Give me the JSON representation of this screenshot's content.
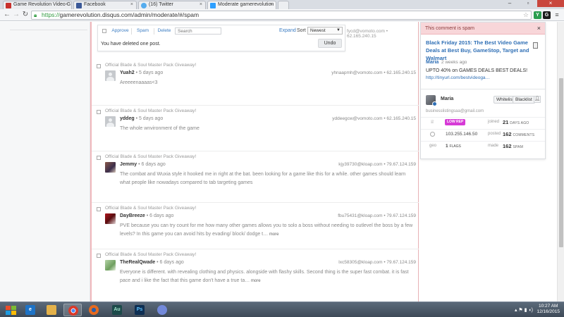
{
  "browser": {
    "tabs": [
      {
        "label": "Game Revolution Video G",
        "favicon_color": "#c8312d",
        "active": false
      },
      {
        "label": "Facebook",
        "favicon_color": "#3b5998",
        "active": false
      },
      {
        "label": "(16) Twitter",
        "favicon_color": "#55acee",
        "active": false
      },
      {
        "label": "Moderate gamerevolution",
        "favicon_color": "#2e9fff",
        "active": true
      }
    ],
    "url_scheme": "https://",
    "url_host": "gamerevolution.disqus.com",
    "url_path": "/admin/moderate/#/spam",
    "ext_y": "Y",
    "ext_g": "G"
  },
  "actionbar": {
    "approve": "Approve",
    "spam": "Spam",
    "delete": "Delete",
    "search_placeholder": "Search",
    "expand": "Expand",
    "sort_label": "Sort",
    "sort_value": "Newest",
    "deleted_msg": "You have deleted one post.",
    "undo": "Undo",
    "partial_meta": "fycd@vomoto.com • 62.165.240.15"
  },
  "comments": [
    {
      "thread": "Official Blade & Soul Master Pack Giveaway!",
      "author": "Yuah2",
      "time": " • 5 days ago",
      "email": "yhnaapmh@vomoto.com • 62.165.240.15",
      "text": "Areeeenaaaas<3",
      "more": ""
    },
    {
      "thread": "Official Blade & Soul Master Pack Giveaway!",
      "author": "yddeg",
      "time": " • 5 days ago",
      "email": "yddeegcw@vomoto.com • 62.165.240.15",
      "text": "The whole wnvironment of the game",
      "more": ""
    },
    {
      "thread": "Official Blade & Soul Master Pack Giveaway!",
      "author": "Jemmy",
      "time": " • 6 days ago",
      "email": "kjy39730@kloap.com • 79.67.124.159",
      "text": "The combat and Wuxia style it hooked me in right at the bat. been looking for a game like this for a while. other games should learn what people like nowadays compared to tab targeting games",
      "more": ""
    },
    {
      "thread": "Official Blade & Soul Master Pack Giveaway!",
      "author": "DayBreeze",
      "time": " • 6 days ago",
      "email": "fbu75431@kloap.com • 79.67.124.159",
      "text": "PVE because you can try count for me how many other games allows you to solo a boss without needing to outlevel the boss by a few levels? In this game you can avoid hits by evading/ block/ dodge t…",
      "more": " more"
    },
    {
      "thread": "Official Blade & Soul Master Pack Giveaway!",
      "author": "TheRealQwade",
      "time": " • 6 days ago",
      "email": "lxc58305@kloap.com • 79.67.124.159",
      "text": "Everyone is different. with revealing clothing and physics. alongside with flashy skills. Second thing is the super fast combat. it is fast pace and i like the fact that this game don't have a true ta…",
      "more": " more"
    }
  ],
  "sidebar": {
    "header": "This comment is spam",
    "close": "×",
    "deal_title": "Black Friday 2015: The Best Video Game Deals at Best Buy, GameStop, Target and Walmart",
    "author": "Maria",
    "time": "2 weeks ago",
    "body": "UPTO 40% on GAMES DEALS BEST DEALS!",
    "link": "http://tinyurl.com/bestvideoga…",
    "user_name": "Maria",
    "whitelist": "Whitelist",
    "blacklist": "Blacklist",
    "user_email": "businesslistingsaa@gmail.com",
    "rep_badge": "LOW REP",
    "joined_label": "joined",
    "joined_value": "21",
    "joined_unit": "DAYS AGO",
    "ip": "103.255.146.50",
    "posted_label": "posted",
    "posted_value": "162",
    "posted_unit": "COMMENTS",
    "geo_label": "geo",
    "flags_value": "1",
    "flags_unit": "FLAGS",
    "made_label": "made",
    "spam_value": "162",
    "spam_unit": "SPAM"
  },
  "taskbar": {
    "apps": [
      {
        "name": "ie",
        "glyph": "e",
        "color": "#1e73c6"
      },
      {
        "name": "explorer",
        "glyph": "",
        "color": "#e3b14a"
      },
      {
        "name": "chrome",
        "glyph": "",
        "color": "#d93a2b"
      },
      {
        "name": "firefox",
        "glyph": "",
        "color": "#e66a1f"
      },
      {
        "name": "audition",
        "glyph": "Au",
        "color": "#1c4a4a"
      },
      {
        "name": "photoshop",
        "glyph": "Ps",
        "color": "#0e2f53"
      },
      {
        "name": "discord",
        "glyph": "",
        "color": "#7289da"
      }
    ],
    "clock_time": "10:27 AM",
    "clock_date": "12/16/2015"
  }
}
